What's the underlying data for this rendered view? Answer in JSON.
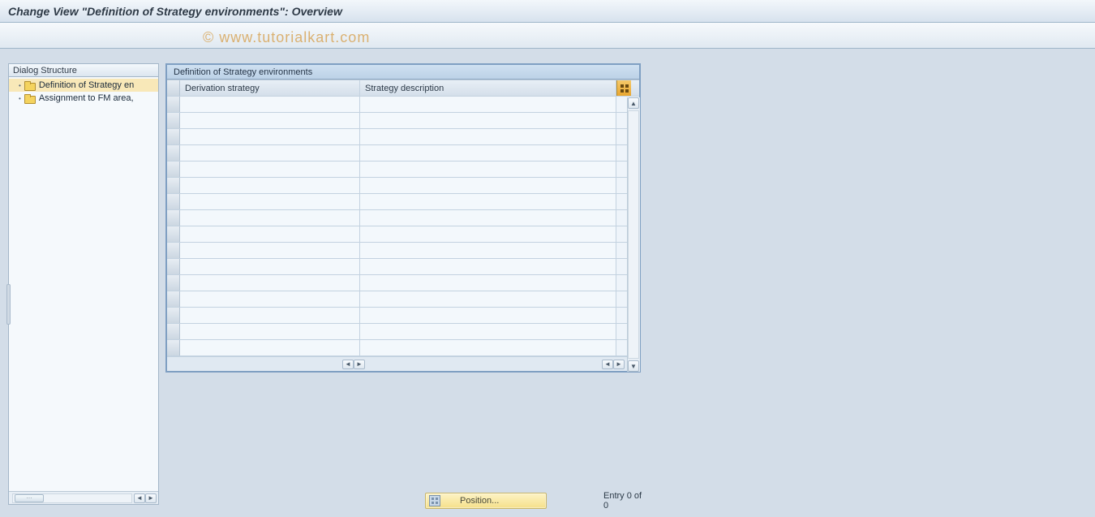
{
  "title": "Change View \"Definition of Strategy environments\": Overview",
  "watermark": "© www.tutorialkart.com",
  "sidebar": {
    "header": "Dialog Structure",
    "items": [
      {
        "label": "Definition of Strategy en",
        "selected": true,
        "icon": "folder-open"
      },
      {
        "label": "Assignment to FM area,",
        "selected": false,
        "icon": "folder-closed"
      }
    ]
  },
  "table": {
    "title": "Definition of Strategy environments",
    "columns": [
      {
        "label": "Derivation strategy"
      },
      {
        "label": "Strategy description"
      }
    ],
    "rows": [
      {
        "c1": "",
        "c2": ""
      },
      {
        "c1": "",
        "c2": ""
      },
      {
        "c1": "",
        "c2": ""
      },
      {
        "c1": "",
        "c2": ""
      },
      {
        "c1": "",
        "c2": ""
      },
      {
        "c1": "",
        "c2": ""
      },
      {
        "c1": "",
        "c2": ""
      },
      {
        "c1": "",
        "c2": ""
      },
      {
        "c1": "",
        "c2": ""
      },
      {
        "c1": "",
        "c2": ""
      },
      {
        "c1": "",
        "c2": ""
      },
      {
        "c1": "",
        "c2": ""
      },
      {
        "c1": "",
        "c2": ""
      },
      {
        "c1": "",
        "c2": ""
      },
      {
        "c1": "",
        "c2": ""
      },
      {
        "c1": "",
        "c2": ""
      }
    ]
  },
  "footer": {
    "position_button": "Position...",
    "status": "Entry 0 of 0"
  }
}
